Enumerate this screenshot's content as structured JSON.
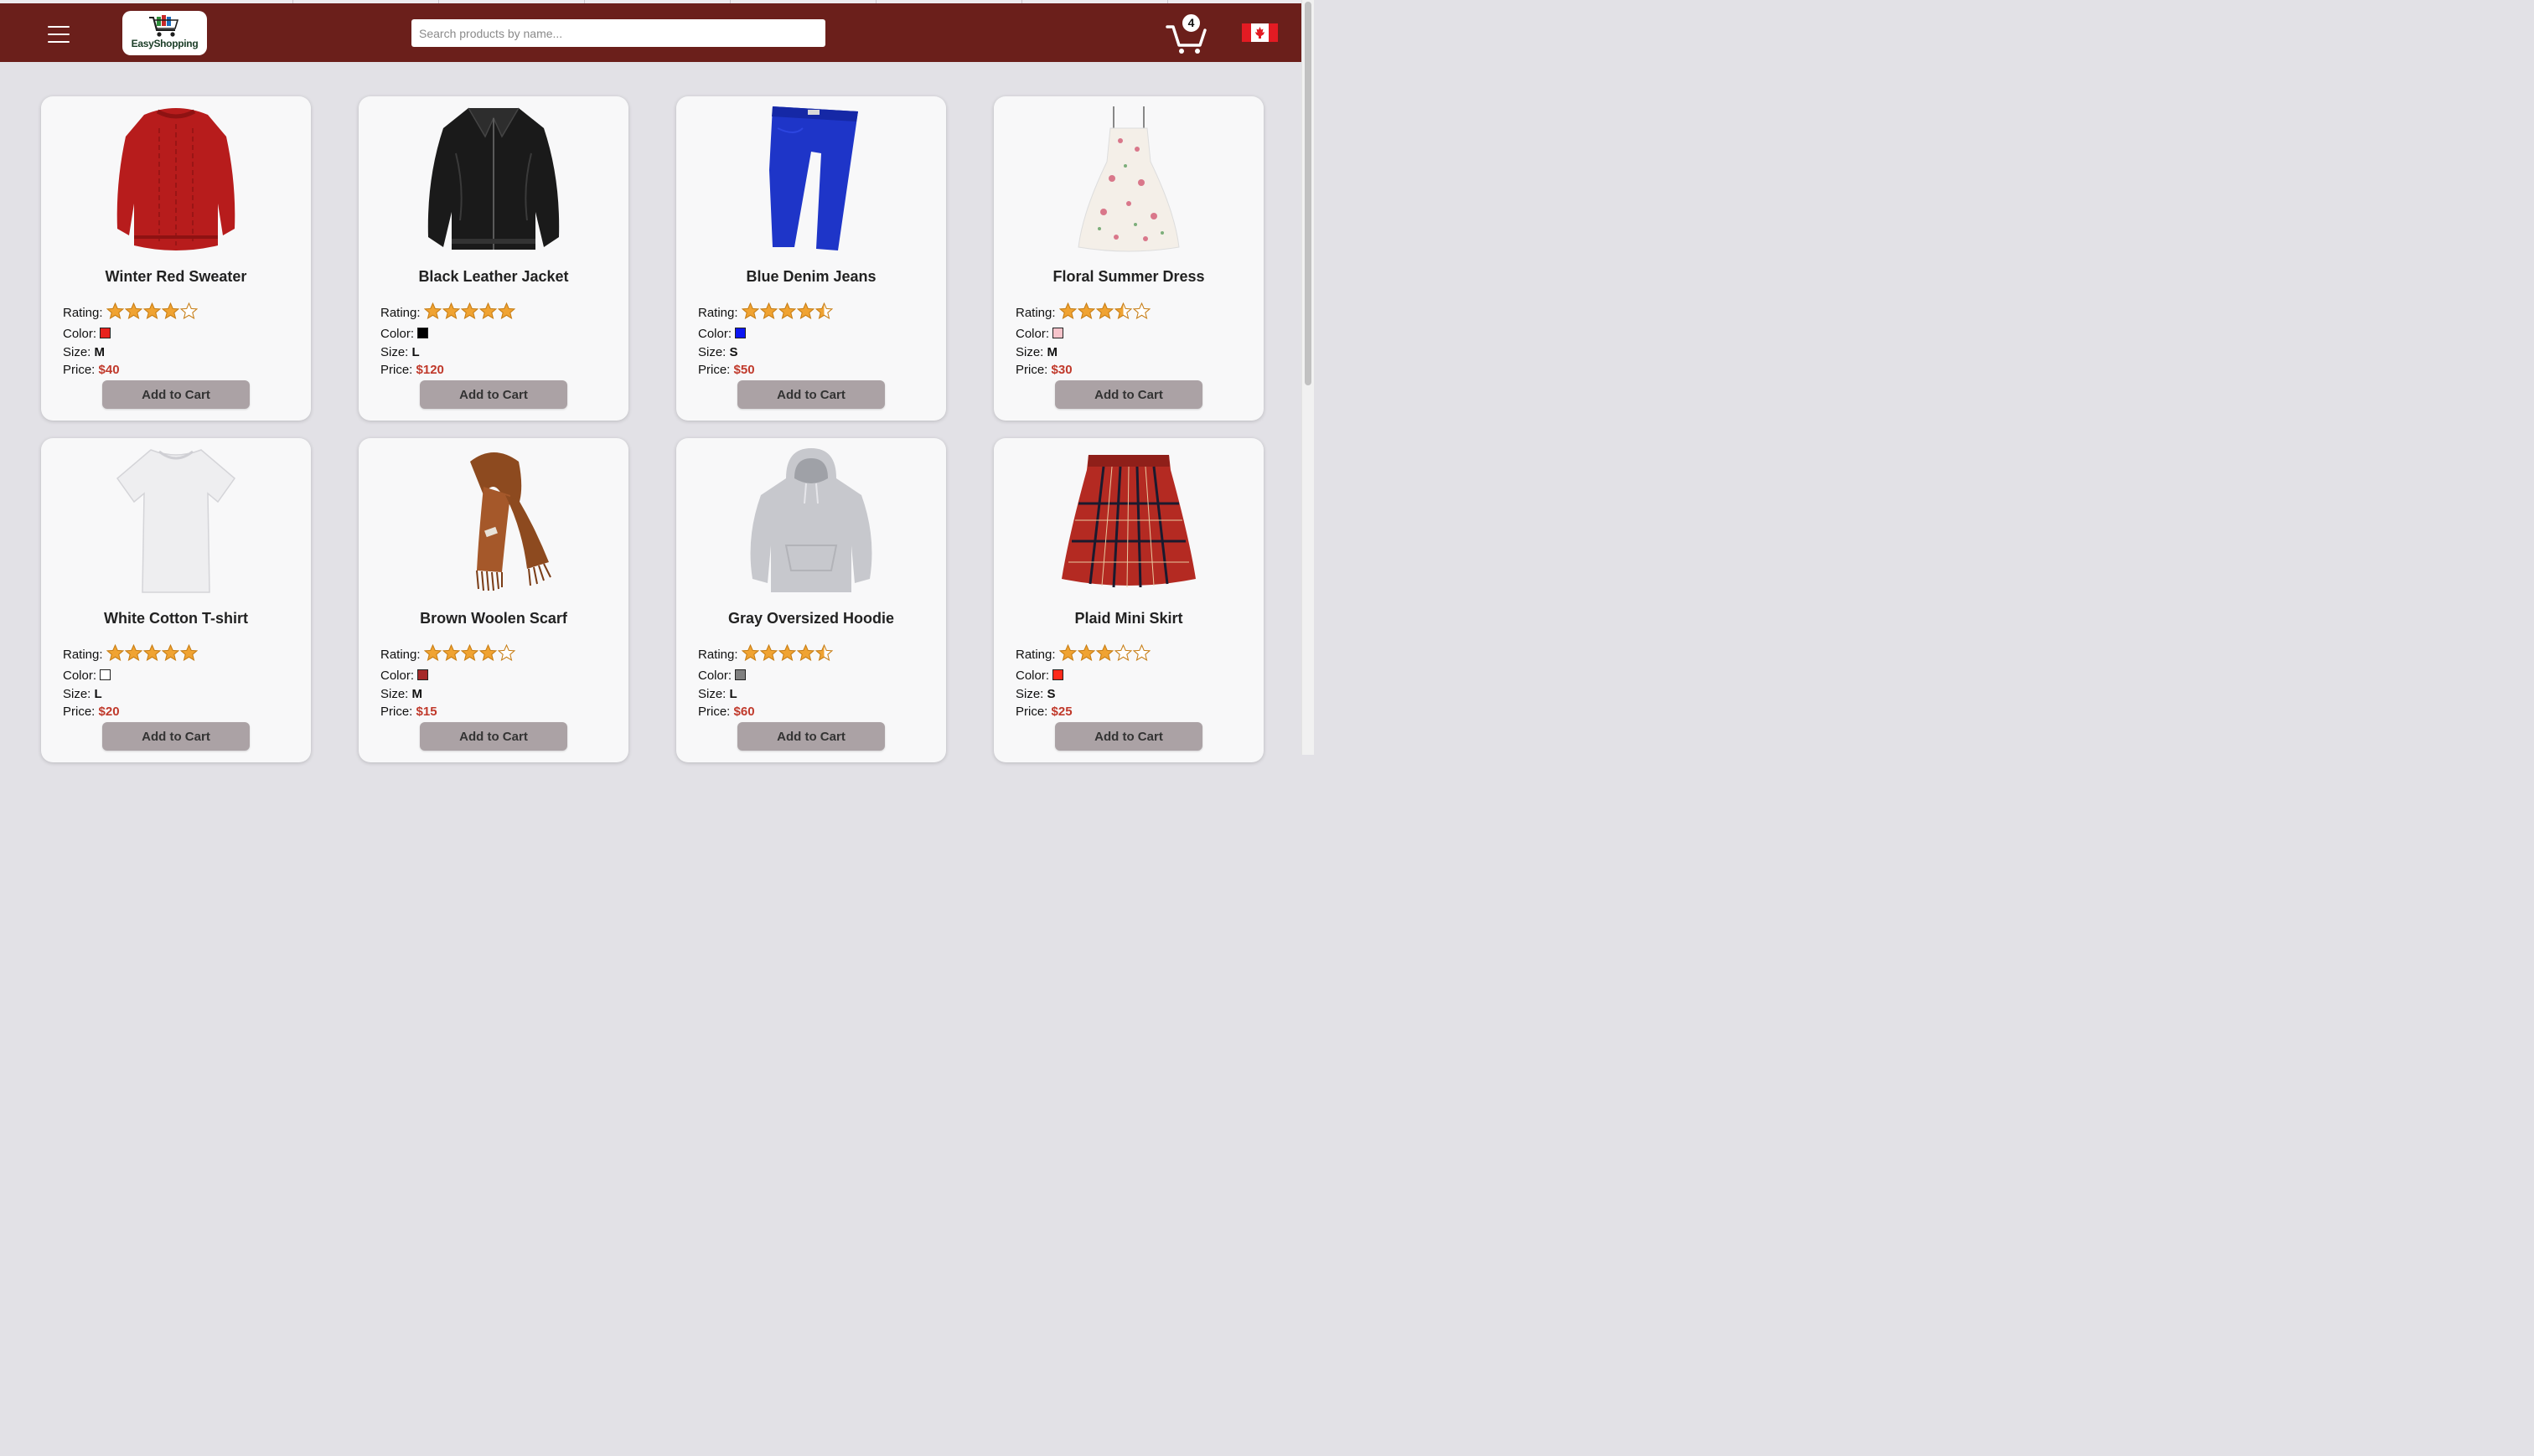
{
  "header": {
    "logo_text": "EasyShopping",
    "search_placeholder": "Search products by name...",
    "cart_count": "4"
  },
  "colors": {
    "header_bg": "#6b1f1b",
    "price": "#c0392b",
    "button": "#aba2a5",
    "star": "#f0a332"
  },
  "labels": {
    "rating": "Rating:",
    "color": "Color:",
    "size": "Size:",
    "price": "Price:"
  },
  "products": [
    {
      "name": "Winter Red Sweater",
      "rating": 4,
      "color_hex": "#e8231e",
      "size": "M",
      "price": "$40",
      "button": "Add to Cart",
      "image_icon": "sweater-image"
    },
    {
      "name": "Black Leather Jacket",
      "rating": 5,
      "color_hex": "#000000",
      "size": "L",
      "price": "$120",
      "button": "Add to Cart",
      "image_icon": "jacket-image"
    },
    {
      "name": "Blue Denim Jeans",
      "rating": 4.5,
      "color_hex": "#0c16f2",
      "size": "S",
      "price": "$50",
      "button": "Add to Cart",
      "image_icon": "jeans-image"
    },
    {
      "name": "Floral Summer Dress",
      "rating": 3.5,
      "color_hex": "#f7c4cb",
      "size": "M",
      "price": "$30",
      "button": "Add to Cart",
      "image_icon": "dress-image"
    },
    {
      "name": "White Cotton T-shirt",
      "rating": 5,
      "color_hex": "#ffffff",
      "size": "L",
      "price": "$20",
      "button": "Add to Cart",
      "image_icon": "tshirt-image"
    },
    {
      "name": "Brown Woolen Scarf",
      "rating": 4,
      "color_hex": "#a52a2a",
      "size": "M",
      "price": "$15",
      "button": "Add to Cart",
      "image_icon": "scarf-image"
    },
    {
      "name": "Gray Oversized Hoodie",
      "rating": 4.5,
      "color_hex": "#808080",
      "size": "L",
      "price": "$60",
      "button": "Add to Cart",
      "image_icon": "hoodie-image"
    },
    {
      "name": "Plaid Mini Skirt",
      "rating": 3,
      "color_hex": "#ff2a1a",
      "size": "S",
      "price": "$25",
      "button": "Add to Cart",
      "image_icon": "skirt-image"
    }
  ]
}
